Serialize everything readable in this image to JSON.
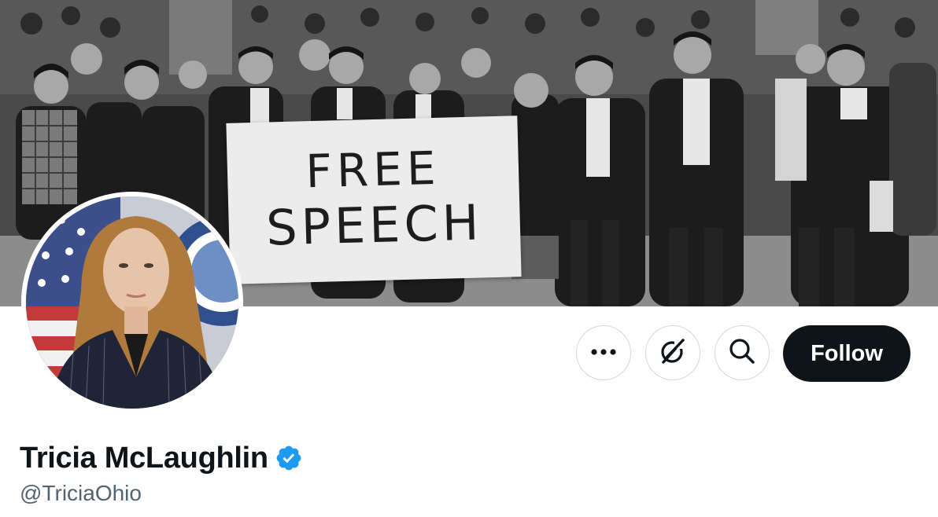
{
  "banner": {
    "sign_line1": "FREE",
    "sign_line2": "SPEECH"
  },
  "avatar": {
    "icon": "profile-photo"
  },
  "actions": {
    "more_icon": "more-horizontal-icon",
    "grok_icon": "grok-icon",
    "search_icon": "search-icon",
    "follow_label": "Follow"
  },
  "profile": {
    "display_name": "Tricia McLaughlin",
    "handle": "@TriciaOhio",
    "verified": true
  },
  "colors": {
    "follow_bg": "#0f1419",
    "verified_blue": "#1d9bf0",
    "handle_gray": "#536471",
    "button_border": "#cfd9de"
  }
}
